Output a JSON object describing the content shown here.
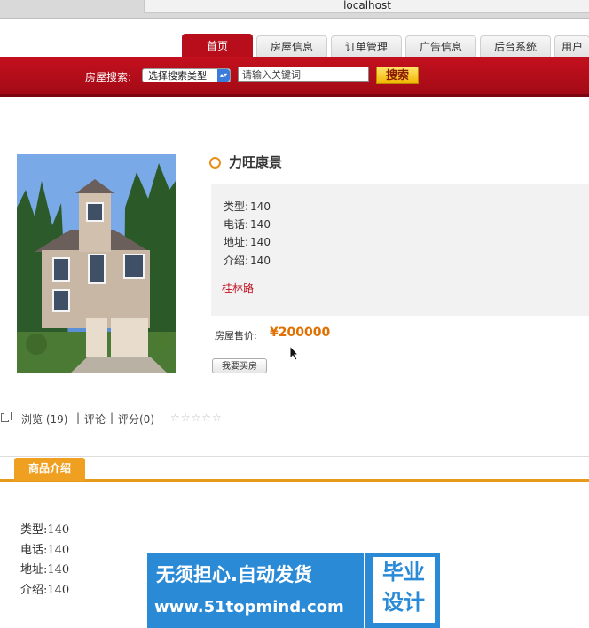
{
  "browser": {
    "address": "localhost"
  },
  "nav": {
    "tabs": [
      {
        "label": "首页",
        "active": true
      },
      {
        "label": "房屋信息"
      },
      {
        "label": "订单管理"
      },
      {
        "label": "广告信息"
      },
      {
        "label": "后台系统"
      },
      {
        "label": "用户"
      }
    ]
  },
  "search": {
    "label": "房屋搜索:",
    "select_value": "选择搜索类型",
    "input_value": "请输入关键词",
    "button_label": "搜索"
  },
  "product": {
    "title": "力旺康景",
    "info": [
      {
        "label": "类型:",
        "value": "140"
      },
      {
        "label": "电话:",
        "value": "140"
      },
      {
        "label": "地址:",
        "value": "140"
      },
      {
        "label": "介绍:",
        "value": "140"
      }
    ],
    "location": "桂林路",
    "price_label": "房屋售价:",
    "price_value": "¥200000",
    "buy_button": "我要买房"
  },
  "stats": {
    "views": "浏览 (19)",
    "sep1": "|",
    "comments": "评论",
    "sep2": "|",
    "rating": "评分(0)",
    "stars": "☆☆☆☆☆"
  },
  "section": {
    "tab_label": "商品介绍",
    "details": [
      {
        "label": "类型:",
        "value": "140"
      },
      {
        "label": "电话:",
        "value": "140"
      },
      {
        "label": "地址:",
        "value": "140"
      },
      {
        "label": "介绍:",
        "value": "140"
      }
    ]
  },
  "watermark": {
    "line1": "无须担心.自动发货",
    "line2": "www.51topmind.com",
    "right_line1": "毕业",
    "right_line2": "设计"
  },
  "colors": {
    "brand_red": "#b80e1c",
    "accent_orange": "#e59a1c",
    "price_orange": "#e07000",
    "watermark_blue": "#2a8ad6"
  }
}
